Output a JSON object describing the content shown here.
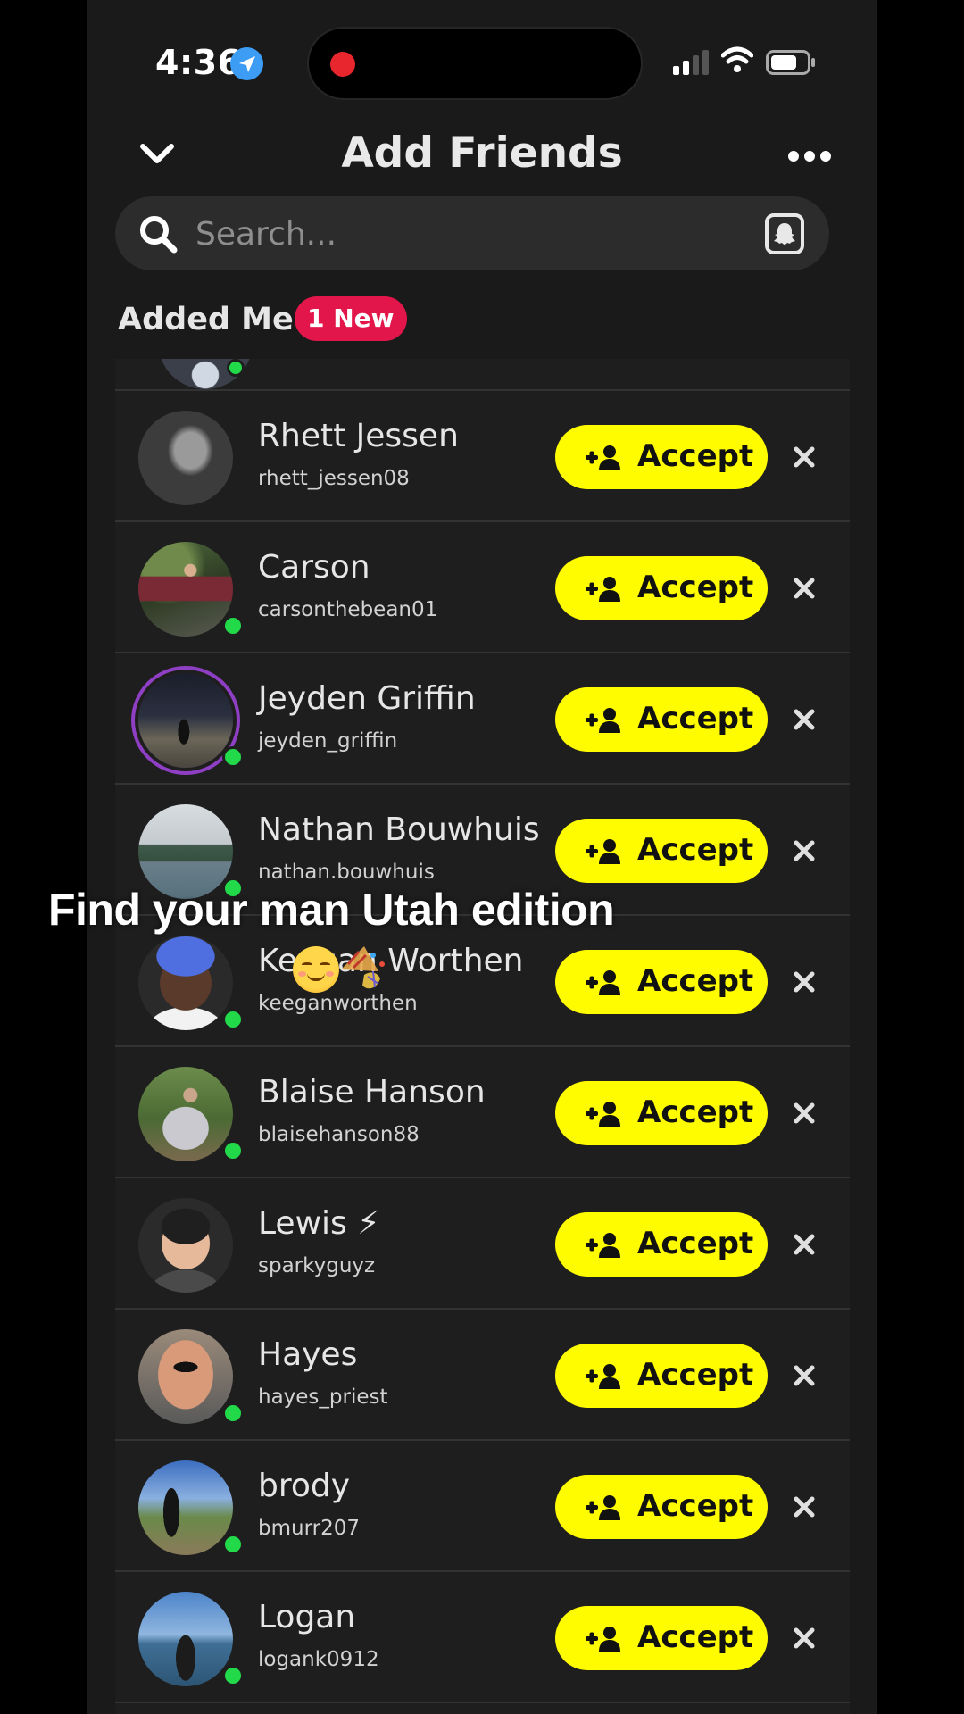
{
  "status_bar": {
    "time": "4:36"
  },
  "header": {
    "title": "Add Friends"
  },
  "search": {
    "placeholder": "Search..."
  },
  "section": {
    "title": "Added Me",
    "badge": "1 New"
  },
  "friends": [
    {
      "name": "Rhett Jessen",
      "username": "rhett_jessen08",
      "accept_label": "Accept"
    },
    {
      "name": "Carson",
      "username": "carsonthebean01",
      "accept_label": "Accept"
    },
    {
      "name": "Jeyden Griffin",
      "username": "jeyden_griffin",
      "accept_label": "Accept"
    },
    {
      "name": "Nathan Bouwhuis",
      "username": "nathan.bouwhuis",
      "accept_label": "Accept"
    },
    {
      "name": "Keegan Worthen",
      "username": "keeganworthen",
      "accept_label": "Accept"
    },
    {
      "name": "Blaise Hanson",
      "username": "blaisehanson88",
      "accept_label": "Accept"
    },
    {
      "name": "Lewis ⚡",
      "username": "sparkyguyz",
      "accept_label": "Accept"
    },
    {
      "name": "Hayes",
      "username": "hayes_priest",
      "accept_label": "Accept"
    },
    {
      "name": "brody",
      "username": "bmurr207",
      "accept_label": "Accept"
    },
    {
      "name": "Logan",
      "username": "logank0912",
      "accept_label": "Accept"
    }
  ],
  "overlay": {
    "caption": "Find your man Utah edition"
  },
  "colors": {
    "accent_yellow": "#fffc00",
    "badge_red": "#e3164b",
    "online_green": "#22d94a",
    "story_ring": "#8e3fc4"
  }
}
